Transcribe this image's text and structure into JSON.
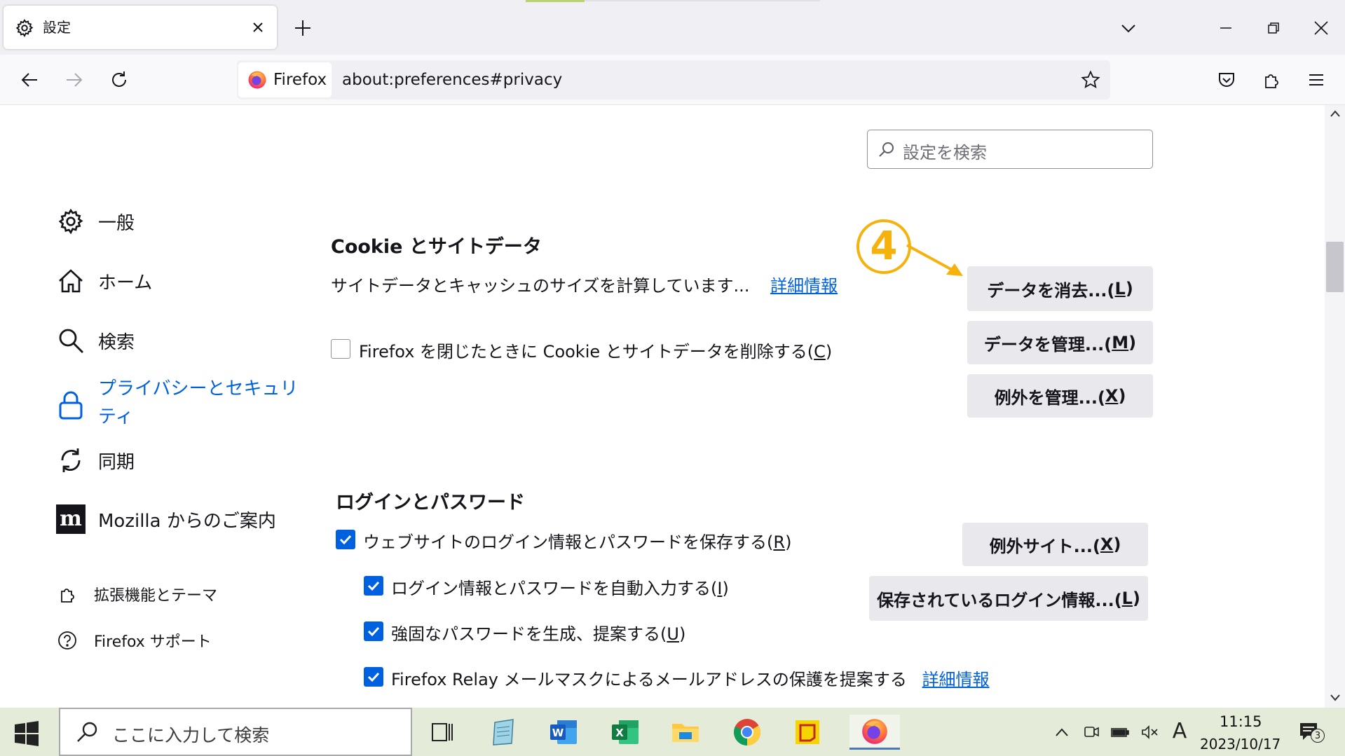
{
  "browser": {
    "tab": {
      "title": "設定",
      "icon": "gear-icon"
    },
    "new_tab_symbol": "+",
    "identity_label": "Firefox",
    "url": "about:preferences#privacy"
  },
  "search": {
    "placeholder": "設定を検索"
  },
  "sidebar": {
    "items": [
      {
        "label": "一般",
        "icon": "gear-icon"
      },
      {
        "label": "ホーム",
        "icon": "home-icon"
      },
      {
        "label": "検索",
        "icon": "search-icon"
      },
      {
        "label_line1": "プライバシーとセキュリ",
        "label_line2": "ティ",
        "icon": "lock-icon",
        "selected": true
      },
      {
        "label": "同期",
        "icon": "sync-icon"
      },
      {
        "label": "Mozilla からのご案内",
        "icon": "mozilla-icon"
      }
    ],
    "footer": [
      {
        "label": "拡張機能とテーマ",
        "icon": "puzzle-icon"
      },
      {
        "label": "Firefox サポート",
        "icon": "help-icon"
      }
    ]
  },
  "cookies": {
    "heading": "Cookie とサイトデータ",
    "size_text": "サイトデータとキャッシュのサイズを計算しています...",
    "learn_more": "詳細情報",
    "delete_on_close_pre": "Firefox を閉じたときに Cookie とサイトデータを削除する(",
    "delete_on_close_key": "C",
    "delete_on_close_post": ")",
    "delete_on_close_checked": false,
    "clear_btn_pre": "データを消去...(",
    "clear_btn_key": "L",
    "manage_btn_pre": "データを管理...(",
    "manage_btn_key": "M",
    "exceptions_btn_pre": "例外を管理...(",
    "exceptions_btn_key": "X",
    "btn_close_paren": ")"
  },
  "annotation": {
    "number": "4",
    "color": "#f5b20d"
  },
  "logins": {
    "heading": "ログインとパスワード",
    "save_pre": "ウェブサイトのログイン情報とパスワードを保存する(",
    "save_key": "R",
    "autofill_pre": "ログイン情報とパスワードを自動入力する(",
    "autofill_key": "I",
    "generate_pre": "強固なパスワードを生成、提案する(",
    "generate_key": "U",
    "relay_text": "Firefox Relay メールマスクによるメールアドレスの保護を提案する",
    "relay_learn_more": "詳細情報",
    "close_paren": ")",
    "exceptions_btn_pre": "例外サイト...(",
    "exceptions_btn_key": "X",
    "saved_logins_btn_pre": "保存されているログイン情報...(",
    "saved_logins_btn_key": "L",
    "all_checked": true
  },
  "taskbar": {
    "search_placeholder": "ここに入力して検索",
    "ime_indicator": "A",
    "time": "11:15",
    "date": "2023/10/17",
    "notifications": "3"
  },
  "colors": {
    "accent": "#0061e0",
    "taskbar": "#e4ebd9"
  }
}
